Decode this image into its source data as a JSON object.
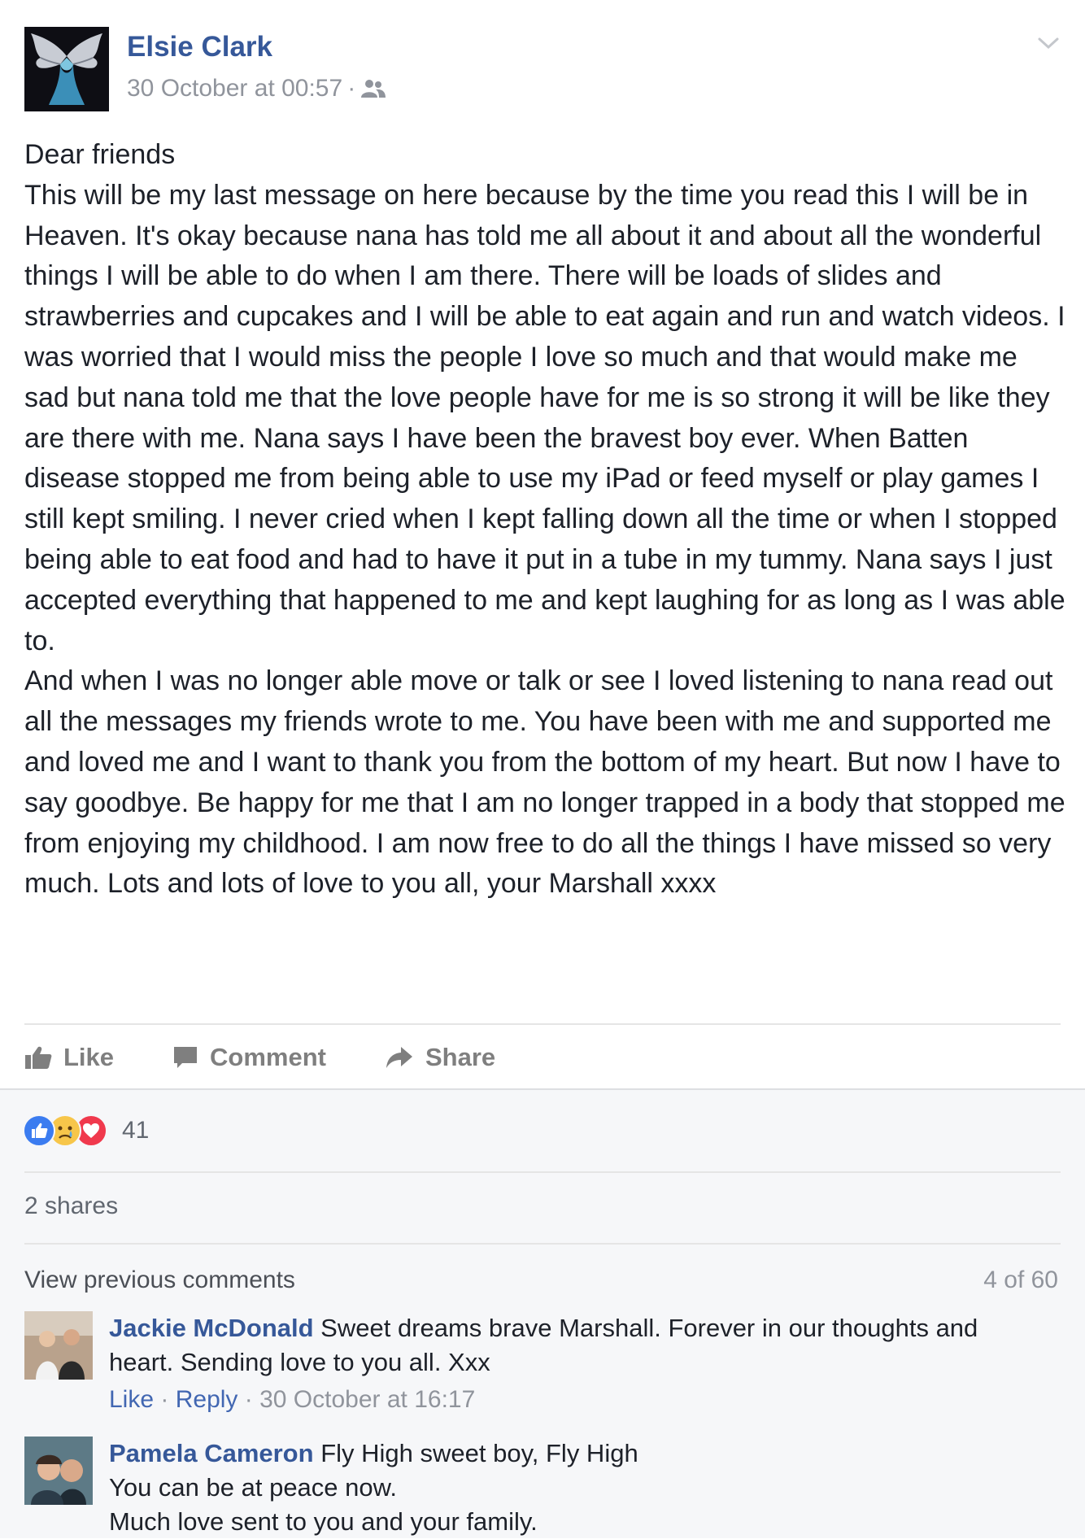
{
  "post": {
    "author": "Elsie Clark",
    "timestamp": "30 October at 00:57",
    "meta_separator": "·",
    "audience_icon": "friends-icon",
    "menu_icon": "chevron-down-icon",
    "paragraphs": [
      "Dear friends",
      "This will be my last message on here because by the time you read this I will be in Heaven. It's okay because nana has told me all about it and about all the wonderful things I will be able to do when I am there. There will be loads of slides and strawberries and cupcakes and I will be able to eat again and run and watch videos. I was worried that I would miss the people I love so much and that would make me sad but nana told me that the love people have for me is so strong it will be like they are there with me. Nana says I have been the bravest boy ever. When Batten disease stopped me from being able to use my iPad or feed myself or play games I still kept smiling. I never cried when I kept falling down all the time or when I stopped being able to eat food and had to have it put in a tube in my tummy. Nana says I just accepted everything that happened to me and kept laughing for as long as I was able to.",
      "And when I was no longer able move or talk or see I loved listening to nana read out all the messages my friends wrote to me. You have been with me and supported me and loved me and I want to thank you from the bottom of my heart. But now I have to say goodbye. Be happy for me that I am no longer trapped in a body that stopped me from enjoying my childhood. I am now free to do all the things I have missed so very much. Lots and lots of love to you all, your Marshall xxxx"
    ]
  },
  "actions": {
    "like": "Like",
    "comment": "Comment",
    "share": "Share"
  },
  "reactions": {
    "count": "41",
    "icons": [
      "like-reaction-icon",
      "sad-reaction-icon",
      "love-reaction-icon"
    ]
  },
  "shares_text": "2 shares",
  "comments_header": {
    "view_previous": "View previous comments",
    "pager": "4 of 60"
  },
  "comments": [
    {
      "name": "Jackie McDonald",
      "text_line1": "Sweet dreams brave Marshall. Forever in our thoughts and",
      "text_line2": "heart. Sending love to you all. Xxx",
      "like": "Like",
      "reply": "Reply",
      "sep": " · ",
      "time": "30 October at 16:17"
    },
    {
      "name": "Pamela Cameron",
      "text_line1": "Fly High sweet boy, Fly High",
      "text_line2": "You can be at peace now.",
      "text_line3": "Much love sent to you and your family."
    }
  ],
  "colors": {
    "link_blue": "#365899",
    "text": "#1d2129",
    "muted": "#90949c",
    "lower_bg": "#f6f7f9"
  }
}
